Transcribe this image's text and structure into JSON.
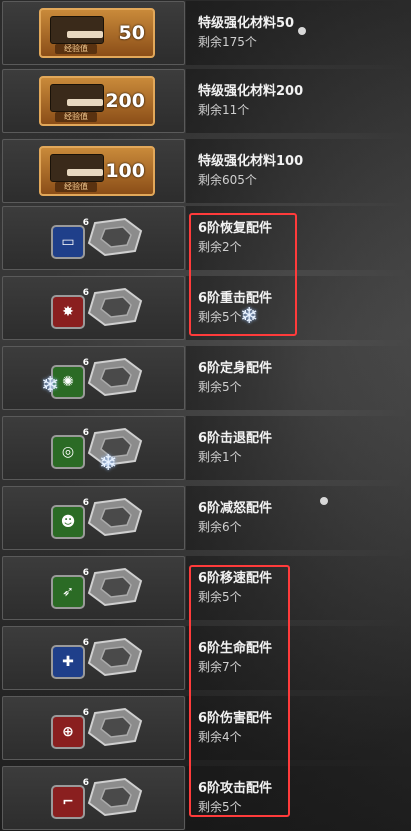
{
  "items": [
    {
      "name": "特级强化材料50",
      "remain": "剩余175个",
      "badge_num": "50",
      "crate_label": "经验值",
      "kind": "crate"
    },
    {
      "name": "特级强化材料200",
      "remain": "剩余11个",
      "badge_num": "200",
      "crate_label": "经验值",
      "kind": "crate"
    },
    {
      "name": "特级强化材料100",
      "remain": "剩余605个",
      "badge_num": "100",
      "crate_label": "经验值",
      "kind": "crate"
    },
    {
      "name": "6阶恢复配件",
      "remain": "剩余2个",
      "level": "6",
      "color": "#1f3f8a",
      "icon": "recover-icon",
      "kind": "part"
    },
    {
      "name": "6阶重击配件",
      "remain": "剩余5个",
      "level": "6",
      "color": "#8a1f1f",
      "icon": "heavy-strike-icon",
      "kind": "part"
    },
    {
      "name": "6阶定身配件",
      "remain": "剩余5个",
      "level": "6",
      "color": "#2b6b25",
      "icon": "immobilize-icon",
      "kind": "part"
    },
    {
      "name": "6阶击退配件",
      "remain": "剩余1个",
      "level": "6",
      "color": "#2b6b25",
      "icon": "knockback-icon",
      "kind": "part"
    },
    {
      "name": "6阶减怒配件",
      "remain": "剩余6个",
      "level": "6",
      "color": "#2b6b25",
      "icon": "rage-reduce-icon",
      "kind": "part"
    },
    {
      "name": "6阶移速配件",
      "remain": "剩余5个",
      "level": "6",
      "color": "#2b6b25",
      "icon": "move-speed-icon",
      "kind": "part"
    },
    {
      "name": "6阶生命配件",
      "remain": "剩余7个",
      "level": "6",
      "color": "#1f3f8a",
      "icon": "life-icon",
      "kind": "part"
    },
    {
      "name": "6阶伤害配件",
      "remain": "剩余4个",
      "level": "6",
      "color": "#8a1f1f",
      "icon": "damage-icon",
      "kind": "part"
    },
    {
      "name": "6阶攻击配件",
      "remain": "剩余5个",
      "level": "6",
      "color": "#8a1f1f",
      "icon": "attack-icon",
      "kind": "part"
    }
  ],
  "highlight_color": "#ff3b3b"
}
